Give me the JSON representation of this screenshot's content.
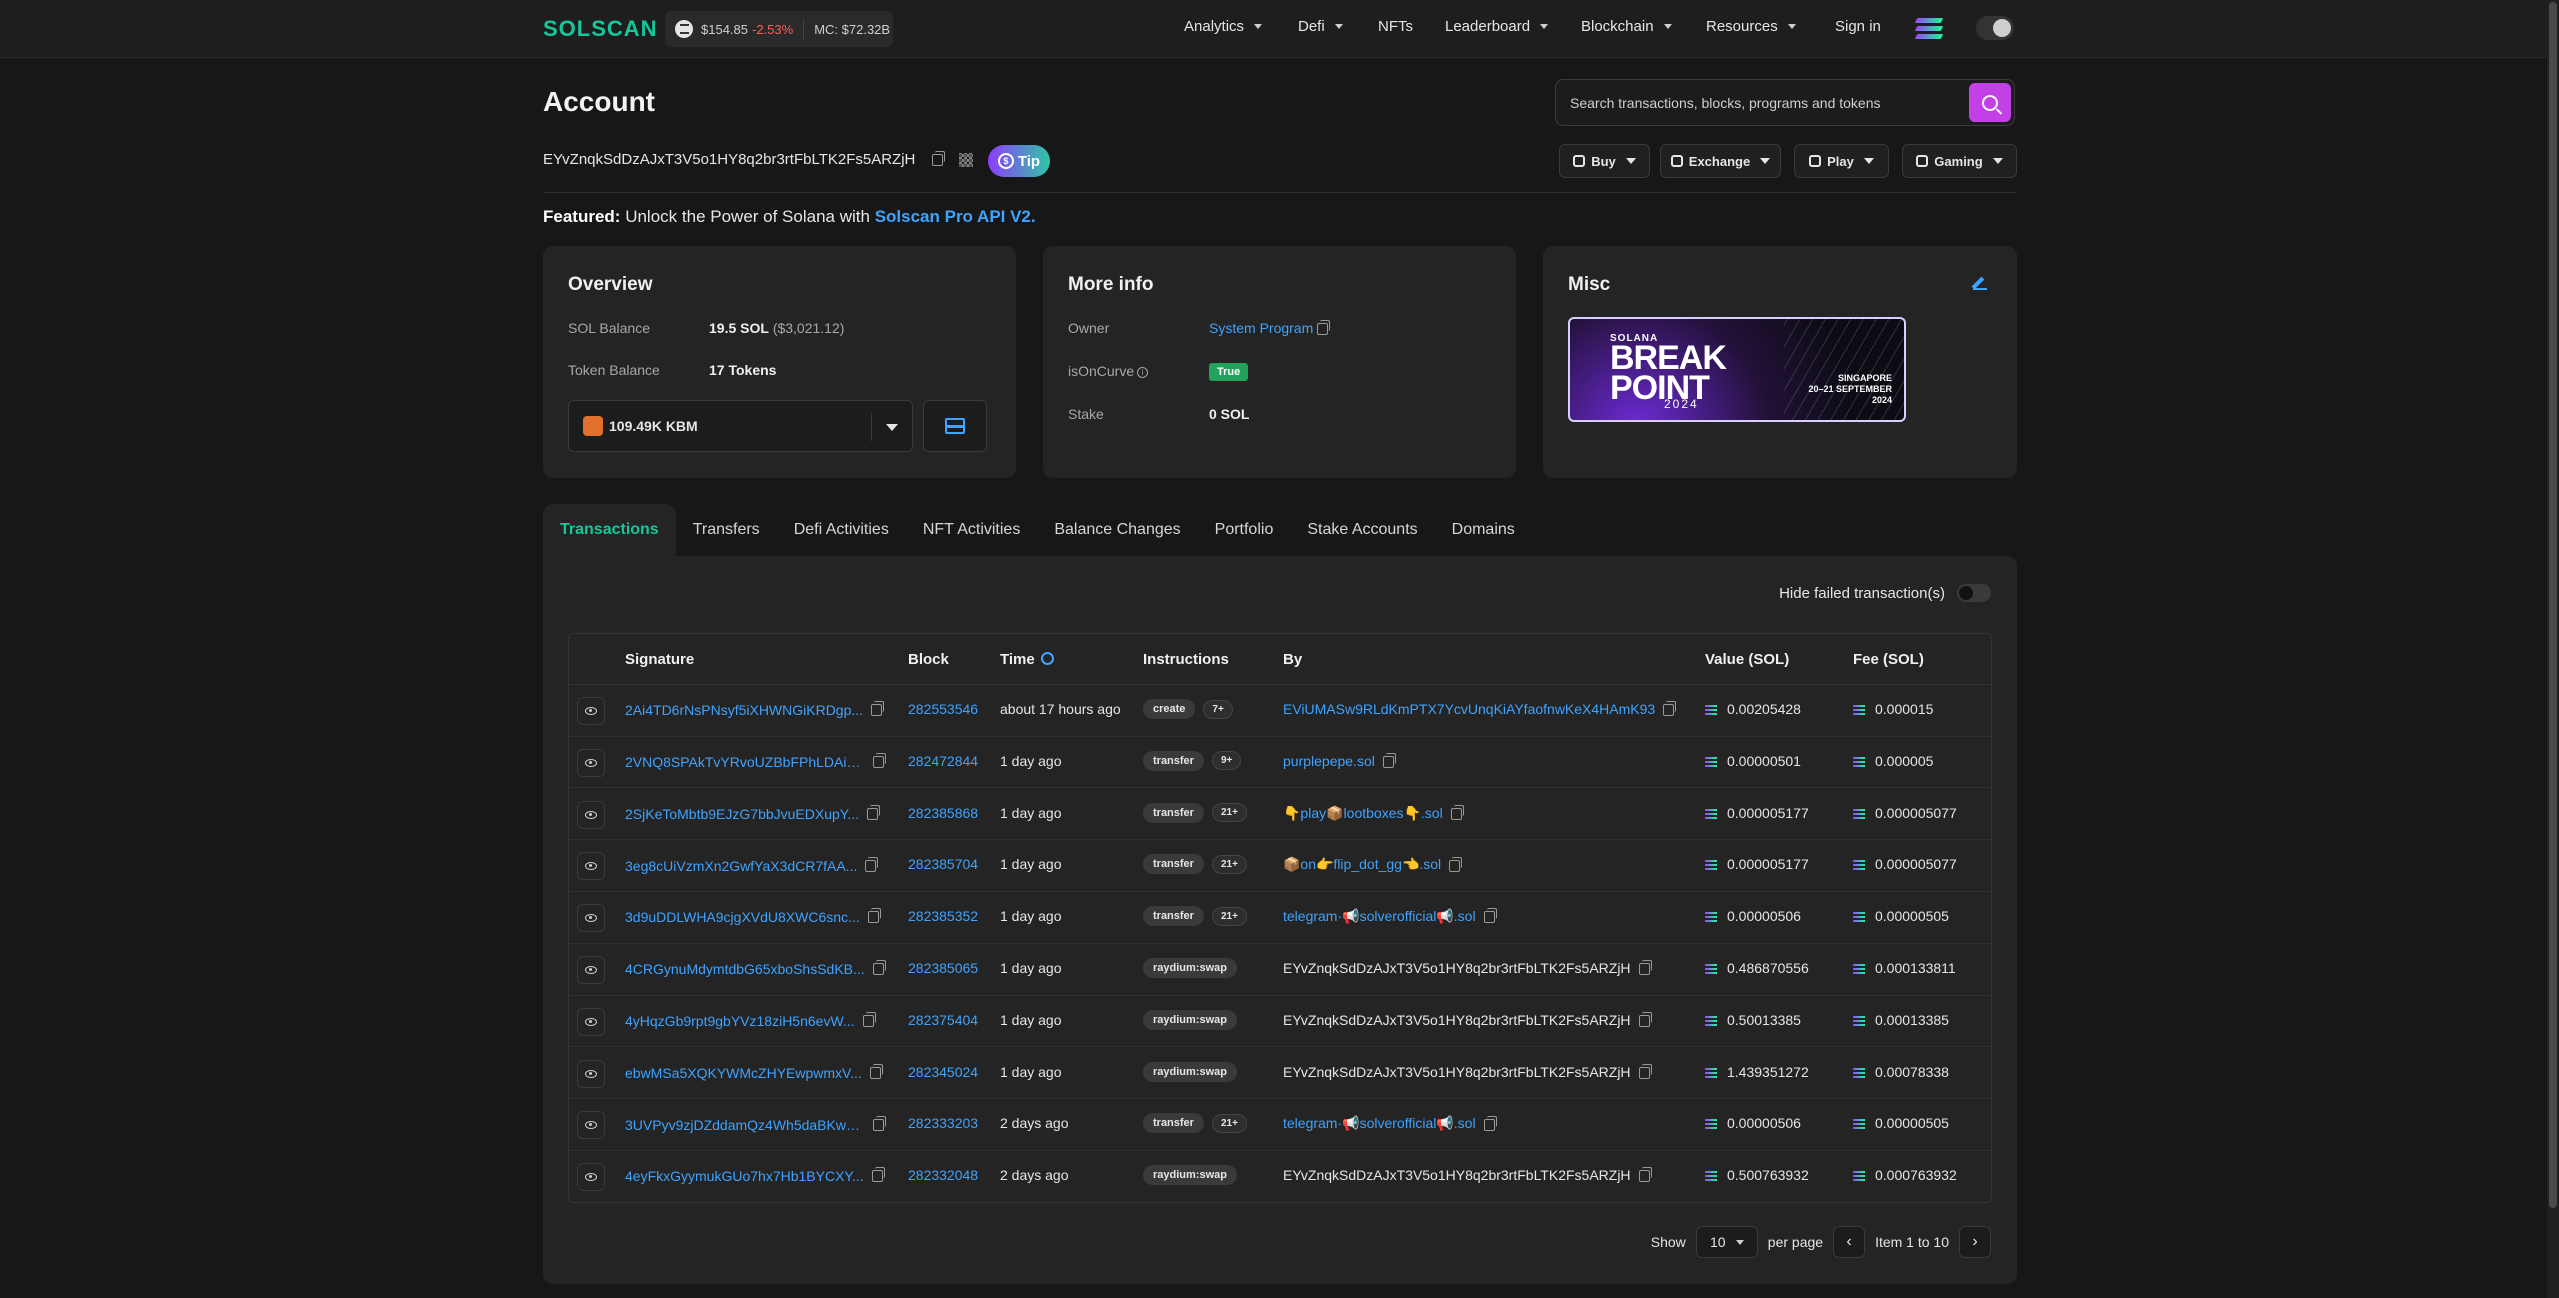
{
  "header": {
    "logo": "SOLSCAN",
    "sol_price": "$154.85",
    "sol_change": "-2.53%",
    "market_cap": "MC: $72.32B",
    "nav": [
      "Analytics",
      "Defi",
      "NFTs",
      "Leaderboard",
      "Blockchain",
      "Resources"
    ],
    "sign_in": "Sign in"
  },
  "page": {
    "title": "Account",
    "address": "EYvZnqkSdDzAJxT3V5o1HY8q2br3rtFbLTK2Fs5ARZjH",
    "tip": "Tip",
    "search_placeholder": "Search transactions, blocks, programs and tokens",
    "actions": [
      "Buy",
      "Exchange",
      "Play",
      "Gaming"
    ]
  },
  "featured": {
    "label": "Featured:",
    "text": "Unlock the Power of Solana with",
    "link": "Solscan Pro API V2."
  },
  "overview": {
    "title": "Overview",
    "sol_balance_label": "SOL Balance",
    "sol_balance": "19.5 SOL",
    "sol_balance_usd": "($3,021.12)",
    "token_balance_label": "Token Balance",
    "token_balance": "17 Tokens",
    "selected_token": "109.49K KBM"
  },
  "more_info": {
    "title": "More info",
    "owner_label": "Owner",
    "owner": "System Program",
    "oncurve_label": "isOnCurve",
    "oncurve": "True",
    "stake_label": "Stake",
    "stake": "0 SOL"
  },
  "misc": {
    "title": "Misc",
    "banner": {
      "brand": "SOLANA",
      "line1": "BREAK",
      "line2": "POINT",
      "year": "2024",
      "place": "SINGAPORE",
      "dates": "20–21 SEPTEMBER",
      "year2": "2024"
    }
  },
  "tabs": [
    "Transactions",
    "Transfers",
    "Defi Activities",
    "NFT Activities",
    "Balance Changes",
    "Portfolio",
    "Stake Accounts",
    "Domains"
  ],
  "table": {
    "hide_failed": "Hide failed transaction(s)",
    "columns": [
      "Signature",
      "Block",
      "Time",
      "Instructions",
      "By",
      "Value (SOL)",
      "Fee (SOL)"
    ],
    "rows": [
      {
        "sig": "2Ai4TD6rNsPNsyf5iXHWNGiKRDgp...",
        "block": "282553546",
        "time": "about 17 hours ago",
        "instr": "create",
        "count": "7+",
        "by": "EViUMASw9RLdKmPTX7YcvUnqKiAYfaofnwKeX4HAmK93",
        "by_link": true,
        "value": "0.00205428",
        "fee": "0.000015"
      },
      {
        "sig": "2VNQ8SPAkTvYRvoUZBbFPhLDAiX...",
        "block": "282472844",
        "time": "1 day ago",
        "instr": "transfer",
        "count": "9+",
        "by": "purplepepe.sol",
        "by_link": true,
        "value": "0.00000501",
        "fee": "0.000005"
      },
      {
        "sig": "2SjKeToMbtb9EJzG7bbJvuEDXupY...",
        "block": "282385868",
        "time": "1 day ago",
        "instr": "transfer",
        "count": "21+",
        "by": "👇play📦lootboxes👇.sol",
        "by_link": true,
        "value": "0.000005177",
        "fee": "0.000005077"
      },
      {
        "sig": "3eg8cUiVzmXn2GwfYaX3dCR7fAA...",
        "block": "282385704",
        "time": "1 day ago",
        "instr": "transfer",
        "count": "21+",
        "by": "📦on👉flip_dot_gg👈.sol",
        "by_link": true,
        "value": "0.000005177",
        "fee": "0.000005077"
      },
      {
        "sig": "3d9uDDLWHA9cjgXVdU8XWC6snc...",
        "block": "282385352",
        "time": "1 day ago",
        "instr": "transfer",
        "count": "21+",
        "by": "telegram·📢solverofficial📢.sol",
        "by_link": true,
        "value": "0.00000506",
        "fee": "0.00000505"
      },
      {
        "sig": "4CRGynuMdymtdbG65xboShsSdKB...",
        "block": "282385065",
        "time": "1 day ago",
        "instr": "raydium:swap",
        "count": "",
        "by": "EYvZnqkSdDzAJxT3V5o1HY8q2br3rtFbLTK2Fs5ARZjH",
        "by_link": false,
        "value": "0.486870556",
        "fee": "0.000133811"
      },
      {
        "sig": "4yHqzGb9rpt9gbYVz18ziH5n6evW...",
        "block": "282375404",
        "time": "1 day ago",
        "instr": "raydium:swap",
        "count": "",
        "by": "EYvZnqkSdDzAJxT3V5o1HY8q2br3rtFbLTK2Fs5ARZjH",
        "by_link": false,
        "value": "0.50013385",
        "fee": "0.00013385"
      },
      {
        "sig": "ebwMSa5XQKYWMcZHYEwpwmxV...",
        "block": "282345024",
        "time": "1 day ago",
        "instr": "raydium:swap",
        "count": "",
        "by": "EYvZnqkSdDzAJxT3V5o1HY8q2br3rtFbLTK2Fs5ARZjH",
        "by_link": false,
        "value": "1.439351272",
        "fee": "0.00078338"
      },
      {
        "sig": "3UVPyv9zjDZddamQz4Wh5daBKw7...",
        "block": "282333203",
        "time": "2 days ago",
        "instr": "transfer",
        "count": "21+",
        "by": "telegram·📢solverofficial📢.sol",
        "by_link": true,
        "value": "0.00000506",
        "fee": "0.00000505"
      },
      {
        "sig": "4eyFkxGyymukGUo7hx7Hb1BYCXY...",
        "block": "282332048",
        "time": "2 days ago",
        "instr": "raydium:swap",
        "count": "",
        "by": "EYvZnqkSdDzAJxT3V5o1HY8q2br3rtFbLTK2Fs5ARZjH",
        "by_link": false,
        "value": "0.500763932",
        "fee": "0.000763932"
      }
    ]
  },
  "pagination": {
    "show": "Show",
    "per_page_value": "10",
    "per_page": "per page",
    "range": "Item 1 to 10"
  }
}
